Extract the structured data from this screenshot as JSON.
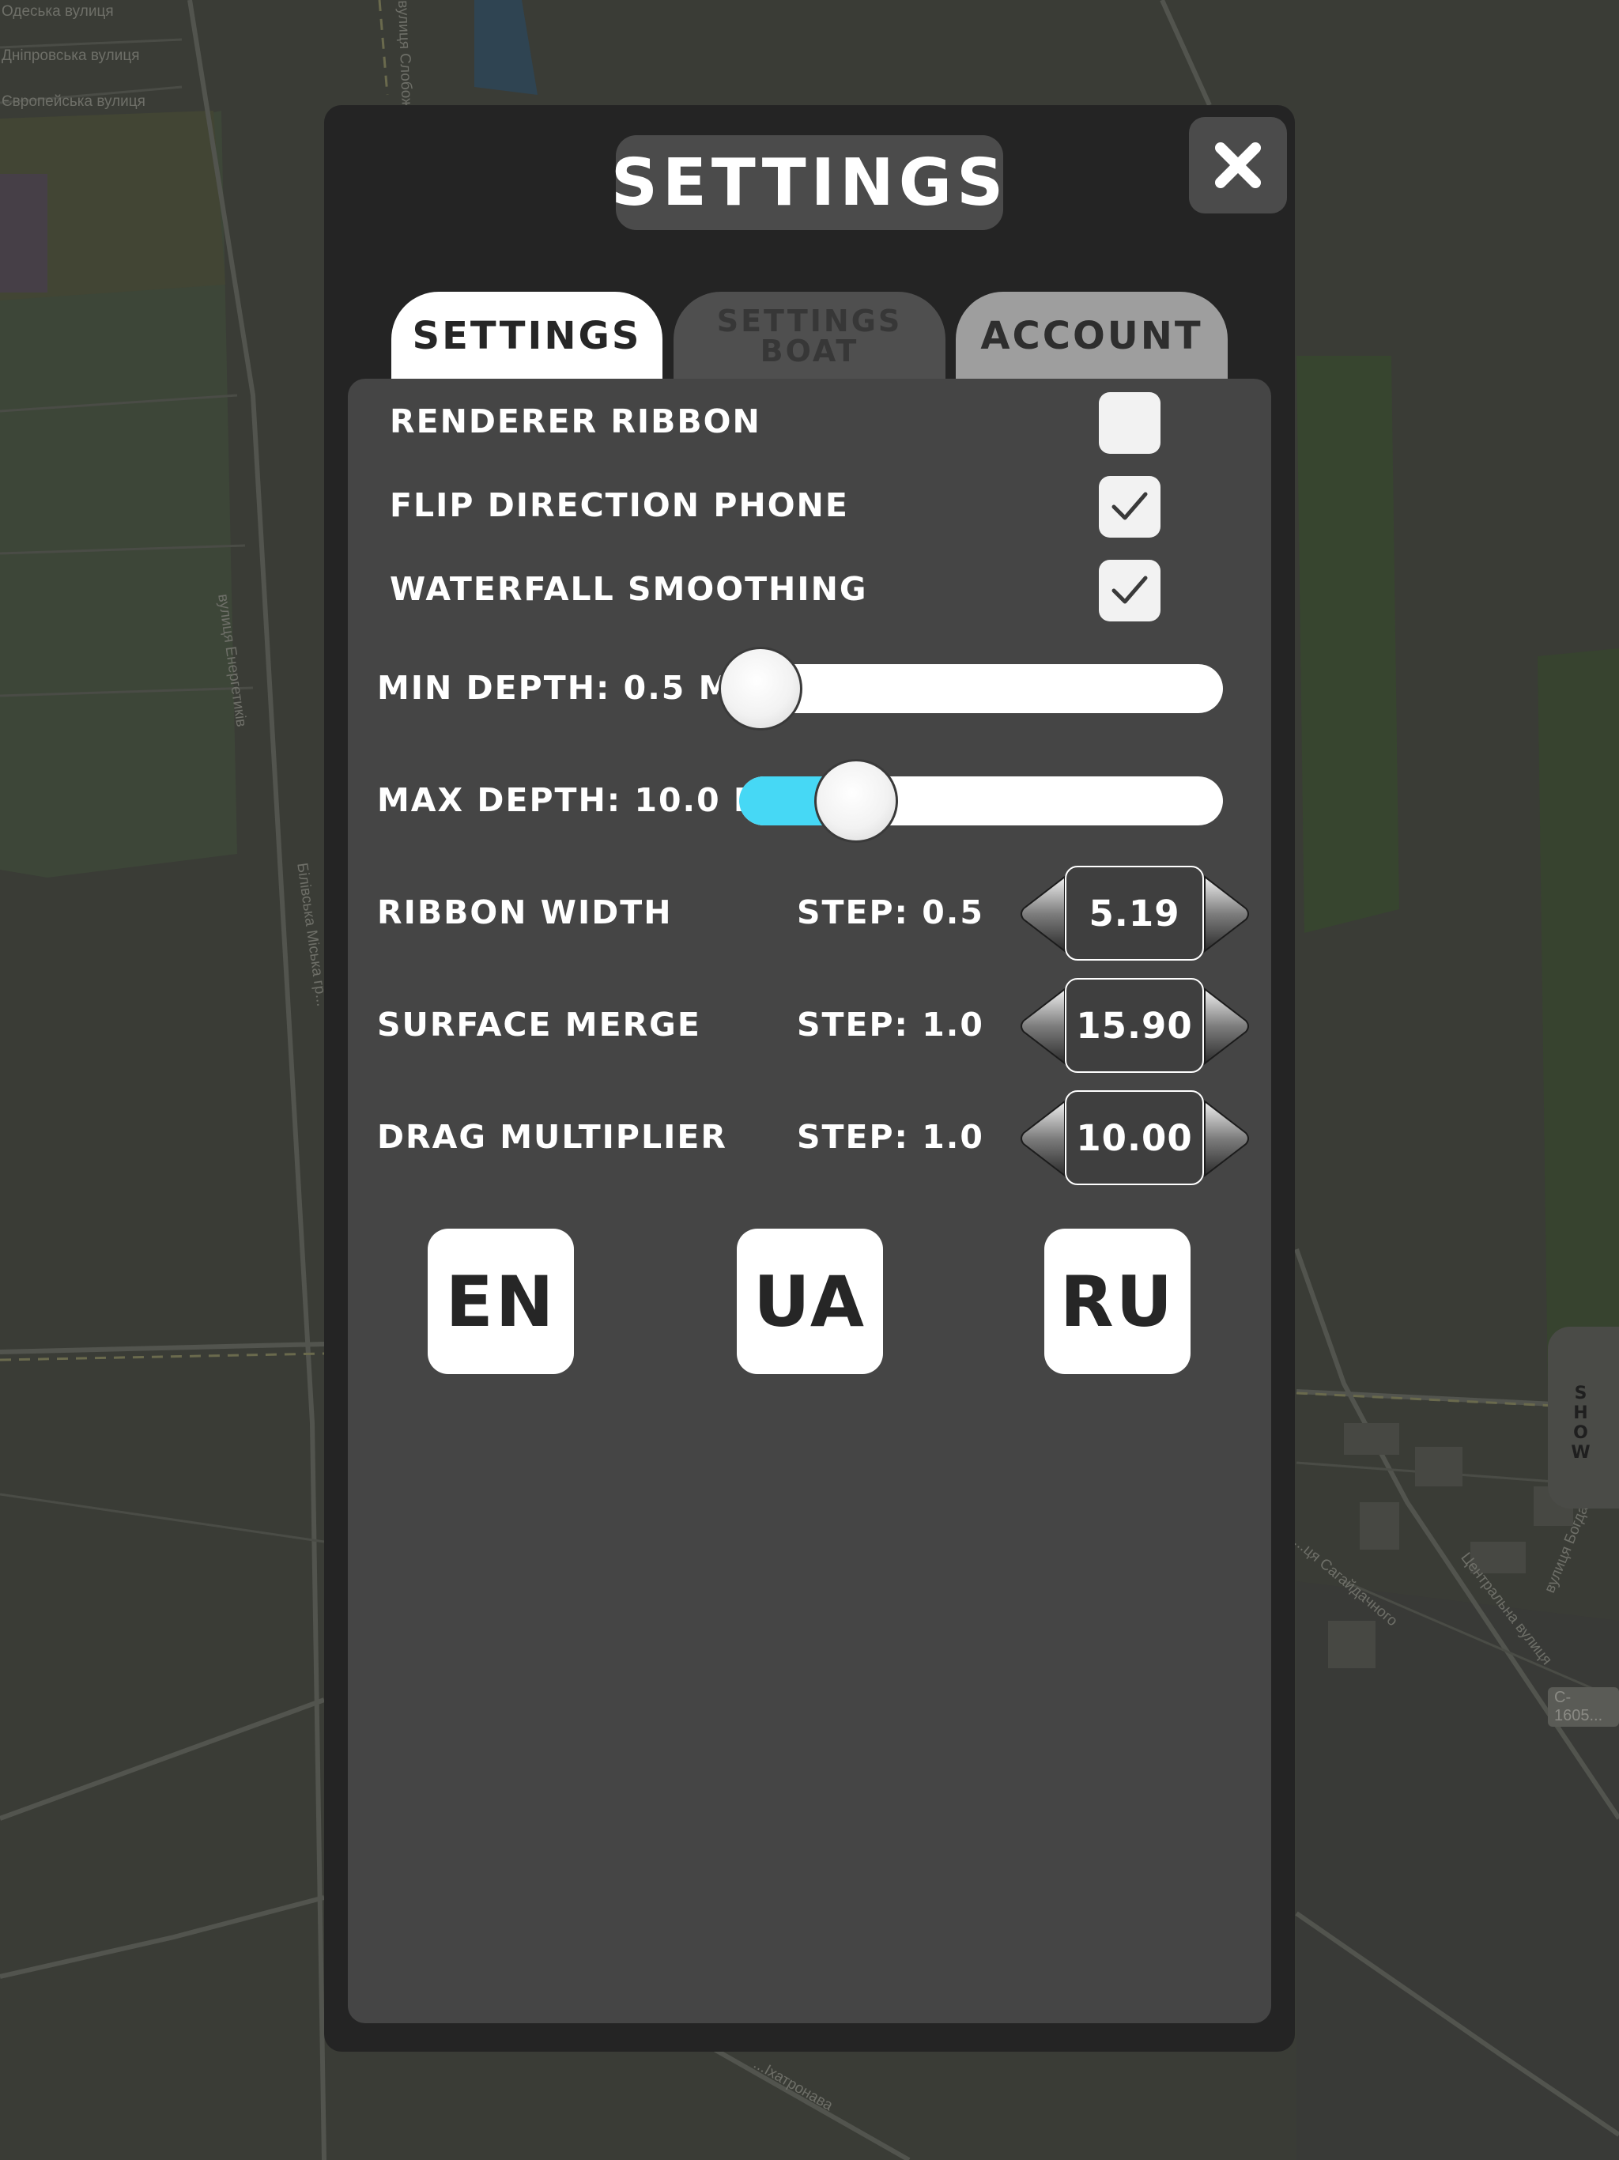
{
  "map": {
    "labels": [
      "Одеська вулиця",
      "Дніпровська вулиця",
      "Європейська вулиця",
      "вулиця Енергетиків",
      "вулиця Слобожанська",
      "Білівська Міська гр...",
      "Центральна вулиця",
      "вулиця Богдана Х...",
      "...ця Сагайдачного",
      "...Іхатронава"
    ],
    "road_code": "C-1605...",
    "show_label": "SHOW"
  },
  "dialog": {
    "title": "SETTINGS",
    "close_icon": "close-icon",
    "tabs": [
      {
        "label": "SETTINGS",
        "active": true
      },
      {
        "label_line1": "SETTINGS",
        "label_line2": "BOAT",
        "active": false
      },
      {
        "label": "ACCOUNT",
        "active": false
      }
    ]
  },
  "toggles": [
    {
      "label": "RENDERER RIBBON",
      "checked": false
    },
    {
      "label": "FLIP DIRECTION PHONE",
      "checked": true
    },
    {
      "label": "WATERFALL SMOOTHING",
      "checked": true
    }
  ],
  "sliders": [
    {
      "label": "MIN DEPTH: 0.5 M",
      "fraction": 0.0
    },
    {
      "label": "MAX DEPTH: 10.0 M",
      "fraction": 0.22
    }
  ],
  "steppers": [
    {
      "label": "RIBBON WIDTH",
      "step": "STEP: 0.5",
      "value": "5.19"
    },
    {
      "label": "SURFACE MERGE",
      "step": "STEP: 1.0",
      "value": "15.90"
    },
    {
      "label": "DRAG MULTIPLIER",
      "step": "STEP: 1.0",
      "value": "10.00"
    }
  ],
  "languages": [
    "EN",
    "UA",
    "RU"
  ],
  "colors": {
    "panel": "#242424",
    "content": "#454545",
    "accent": "#46d8f5",
    "tab_active": "#ffffff",
    "tab_inactive": "#4f4f4f",
    "tab_account": "#9e9e9e"
  }
}
